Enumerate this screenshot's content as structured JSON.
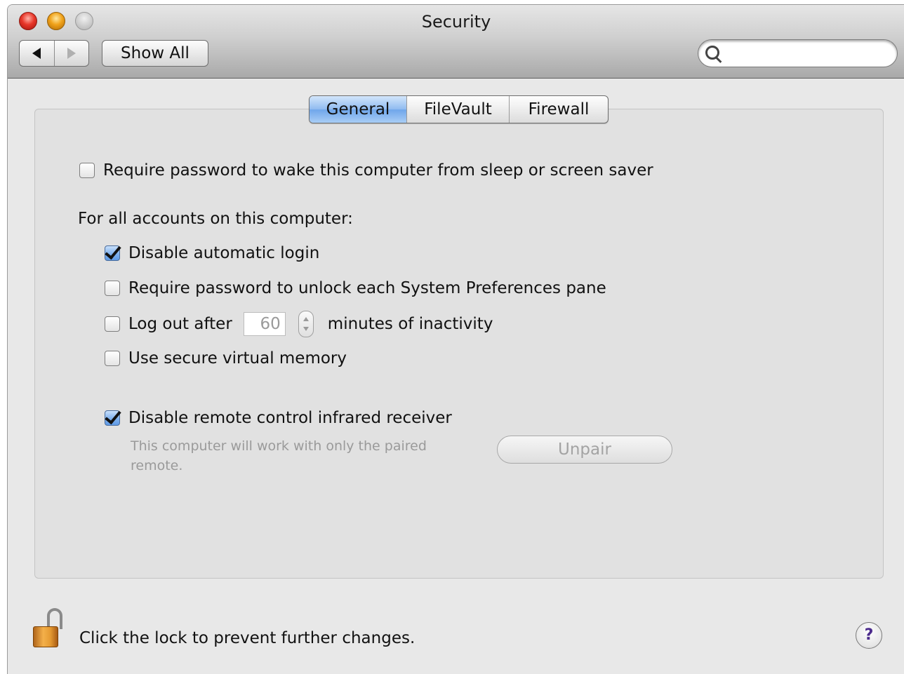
{
  "window": {
    "title": "Security"
  },
  "toolbar": {
    "back_icon": "back-arrow-icon",
    "forward_icon": "forward-arrow-icon",
    "show_all_label": "Show All",
    "search_value": "",
    "search_placeholder": ""
  },
  "tabs": [
    {
      "label": "General",
      "selected": true
    },
    {
      "label": "FileVault",
      "selected": false
    },
    {
      "label": "Firewall",
      "selected": false
    }
  ],
  "general": {
    "require_password_wake": {
      "label": "Require password to wake this computer from sleep or screen saver",
      "checked": false
    },
    "all_accounts_heading": "For all accounts on this computer:",
    "disable_auto_login": {
      "label": "Disable automatic login",
      "checked": true
    },
    "require_password_unlock": {
      "label": "Require password to unlock each System Preferences pane",
      "checked": false
    },
    "logout_after": {
      "label_before": "Log out after",
      "minutes": "60",
      "label_after": "minutes of inactivity",
      "checked": false
    },
    "secure_virtual_memory": {
      "label": "Use secure virtual memory",
      "checked": false
    },
    "disable_infrared": {
      "label": "Disable remote control infrared receiver",
      "checked": true
    },
    "infrared_note": "This computer will work with only the paired remote.",
    "unpair_label": "Unpair"
  },
  "footer": {
    "lock_text": "Click the lock to prevent further changes.",
    "lock_icon": "lock-open-icon",
    "help_label": "?"
  },
  "colors": {
    "tab_selected": "#8fbbf0",
    "lock_gold": "#e59a32",
    "help_purple": "#4b2a8c"
  }
}
